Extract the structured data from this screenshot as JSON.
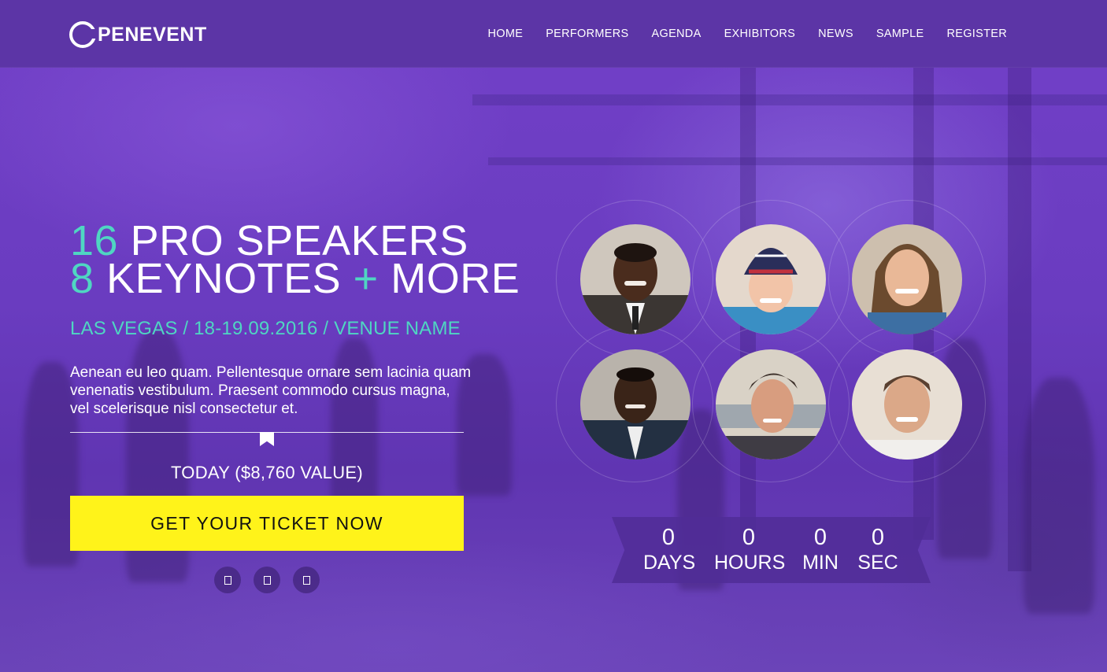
{
  "brand": {
    "logo_text": "PENEVENT"
  },
  "nav": {
    "items": [
      "HOME",
      "PERFORMERS",
      "AGENDA",
      "EXHIBITORS",
      "NEWS",
      "SAMPLE",
      "REGISTER"
    ]
  },
  "hero": {
    "line1_number": "16",
    "line1_text": "PRO SPEAKERS",
    "line2_number": "8",
    "line2_text": "KEYNOTES",
    "line2_plus": "+",
    "line2_more": "MORE",
    "location": "LAS VEGAS / 18-19.09.2016 / VENUE NAME",
    "description": "Aenean eu leo quam. Pellentesque ornare sem lacinia quam venenatis vestibulum. Praesent commodo cursus magna, vel scelerisque nisl consectetur et.",
    "today": "TODAY ($8,760 VALUE)",
    "cta": "GET YOUR TICKET NOW"
  },
  "social": [
    "",
    "",
    ""
  ],
  "countdown": {
    "days": {
      "value": "0",
      "label": "DAYS"
    },
    "hours": {
      "value": "0",
      "label": "HOURS"
    },
    "min": {
      "value": "0",
      "label": "MIN"
    },
    "sec": {
      "value": "0",
      "label": "SEC"
    }
  },
  "colors": {
    "accent": "#4fd6c2",
    "cta_bg": "#fff31a",
    "header_bg": "#5c35a6"
  }
}
